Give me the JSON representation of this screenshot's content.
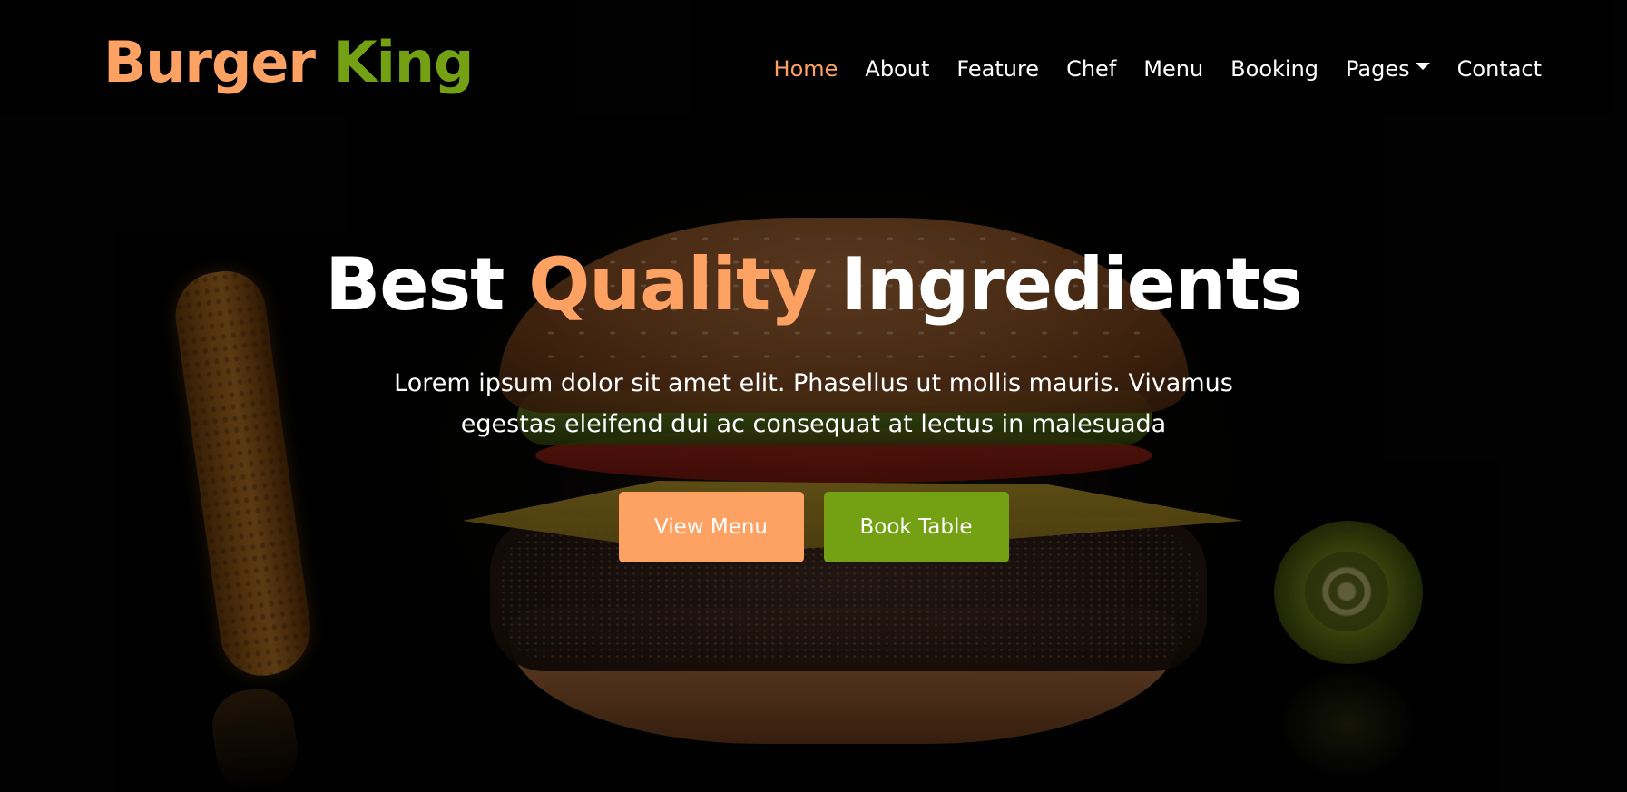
{
  "brand": {
    "part1": "Burger",
    "part2": "King",
    "color_part1": "#fea263",
    "color_part2": "#73a113"
  },
  "nav": {
    "items": [
      {
        "label": "Home",
        "active": true
      },
      {
        "label": "About",
        "active": false
      },
      {
        "label": "Feature",
        "active": false
      },
      {
        "label": "Chef",
        "active": false
      },
      {
        "label": "Menu",
        "active": false
      },
      {
        "label": "Booking",
        "active": false
      },
      {
        "label": "Pages",
        "active": false,
        "dropdown": true,
        "icon": "caret-down-icon"
      },
      {
        "label": "Contact",
        "active": false
      }
    ]
  },
  "hero": {
    "title_part1": "Best",
    "title_accent": "Quality",
    "title_part2": "Ingredients",
    "text_line1": "Lorem ipsum dolor sit amet elit. Phasellus ut mollis mauris. Vivamus",
    "text_line2": "egestas eleifend dui ac consequat at lectus in malesuada",
    "primary_button": "View Menu",
    "secondary_button": "Book Table"
  },
  "colors": {
    "accent": "#fea263",
    "green": "#73a113",
    "text": "#ffffff",
    "background": "#000000"
  }
}
